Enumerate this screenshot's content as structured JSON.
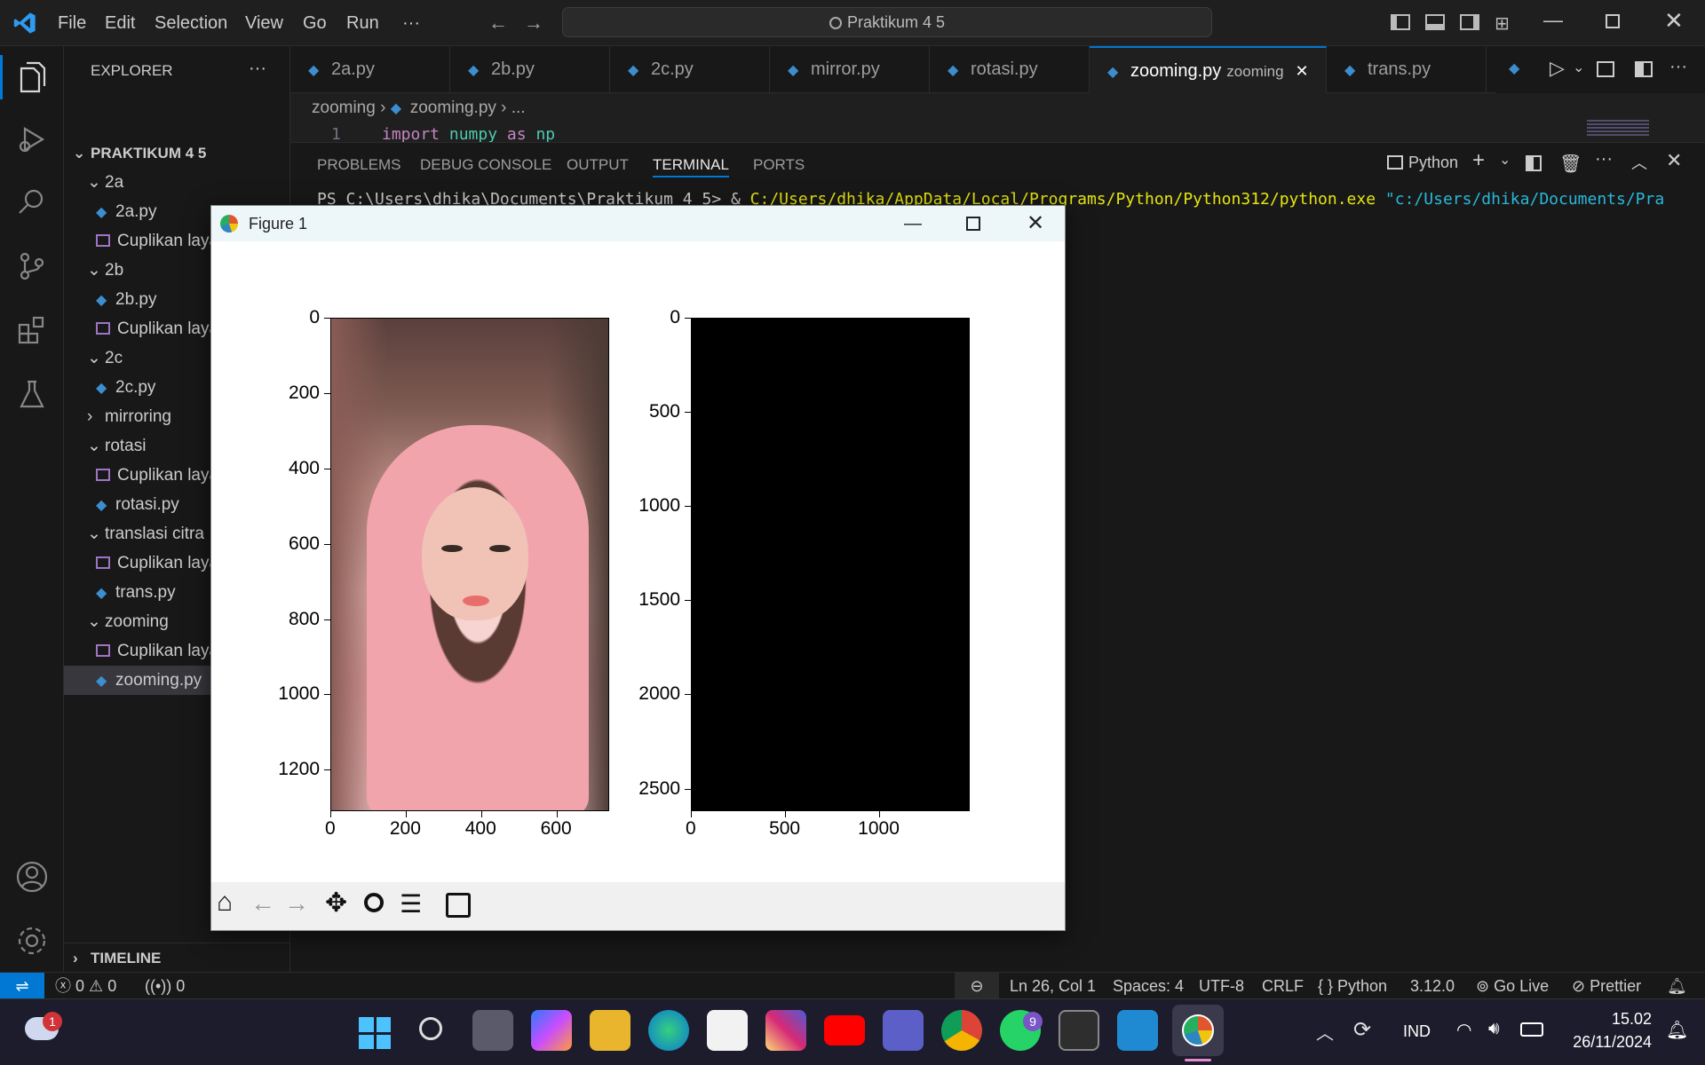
{
  "menu": {
    "file": "File",
    "edit": "Edit",
    "selection": "Selection",
    "view": "View",
    "go": "Go",
    "run": "Run",
    "more": "···"
  },
  "search": {
    "text": "Praktikum 4 5"
  },
  "explorer": {
    "title": "EXPLORER",
    "more": "···",
    "root": "PRAKTIKUM 4 5",
    "timeline": "TIMELINE",
    "items": [
      {
        "label": "2a",
        "type": "folder",
        "open": true
      },
      {
        "label": "2a.py",
        "type": "py"
      },
      {
        "label": "Cuplikan layar 2024-...",
        "type": "img"
      },
      {
        "label": "2b",
        "type": "folder",
        "open": true
      },
      {
        "label": "2b.py",
        "type": "py"
      },
      {
        "label": "Cuplikan layar",
        "type": "img"
      },
      {
        "label": "2c",
        "type": "folder",
        "open": true
      },
      {
        "label": "2c.py",
        "type": "py"
      },
      {
        "label": "mirroring",
        "type": "folder",
        "open": false
      },
      {
        "label": "rotasi",
        "type": "folder",
        "open": true
      },
      {
        "label": "Cuplikan layar",
        "type": "img"
      },
      {
        "label": "rotasi.py",
        "type": "py"
      },
      {
        "label": "translasi citra",
        "type": "folder",
        "open": true
      },
      {
        "label": "Cuplikan layar",
        "type": "img"
      },
      {
        "label": "trans.py",
        "type": "py"
      },
      {
        "label": "zooming",
        "type": "folder",
        "open": true
      },
      {
        "label": "Cuplikan layar",
        "type": "img"
      },
      {
        "label": "zooming.py",
        "type": "py",
        "selected": true
      }
    ]
  },
  "tabs": [
    {
      "label": "2a.py"
    },
    {
      "label": "2b.py"
    },
    {
      "label": "2c.py"
    },
    {
      "label": "mirror.py"
    },
    {
      "label": "rotasi.py"
    },
    {
      "label": "zooming.py",
      "desc": "zooming",
      "active": true
    },
    {
      "label": "trans.py"
    }
  ],
  "breadcrumb": {
    "folder": "zooming",
    "file": "zooming.py",
    "rest": "..."
  },
  "editor": {
    "line_no": "1",
    "code_kw": "import",
    "code_mod": "numpy",
    "code_as": "as",
    "code_alias": "np"
  },
  "panel": {
    "tabs": [
      "PROBLEMS",
      "DEBUG CONSOLE",
      "OUTPUT",
      "TERMINAL",
      "PORTS"
    ],
    "shell": "Python",
    "terminal_prompt": "PS C:\\Users\\dhika\\Documents\\Praktikum 4 5> & ",
    "terminal_exe": "C:/Users/dhika/AppData/Local/Programs/Python/Python312/python.exe",
    "terminal_arg": "\"c:/Users/dhika/Documents/Pra"
  },
  "figure": {
    "title": "Figure 1",
    "left_yticks": [
      "0",
      "200",
      "400",
      "600",
      "800",
      "1000",
      "1200"
    ],
    "left_xticks": [
      "0",
      "200",
      "400",
      "600"
    ],
    "right_yticks": [
      "0",
      "500",
      "1000",
      "1500",
      "2000",
      "2500"
    ],
    "right_xticks": [
      "0",
      "500",
      "1000"
    ]
  },
  "status": {
    "errors": "0",
    "warnings": "0",
    "ports": "0",
    "position": "Ln 26, Col 1",
    "spaces": "Spaces: 4",
    "encoding": "UTF-8",
    "eol": "CRLF",
    "language": "Python",
    "version": "3.12.0",
    "golive": "Go Live",
    "prettier": "Prettier"
  },
  "taskbar": {
    "weather_badge": "1",
    "whatsapp_badge": "9",
    "lang": "IND",
    "time": "15.02",
    "date": "26/11/2024"
  },
  "colors": {
    "accent": "#0078d4",
    "status_remote": "#0078d4"
  }
}
